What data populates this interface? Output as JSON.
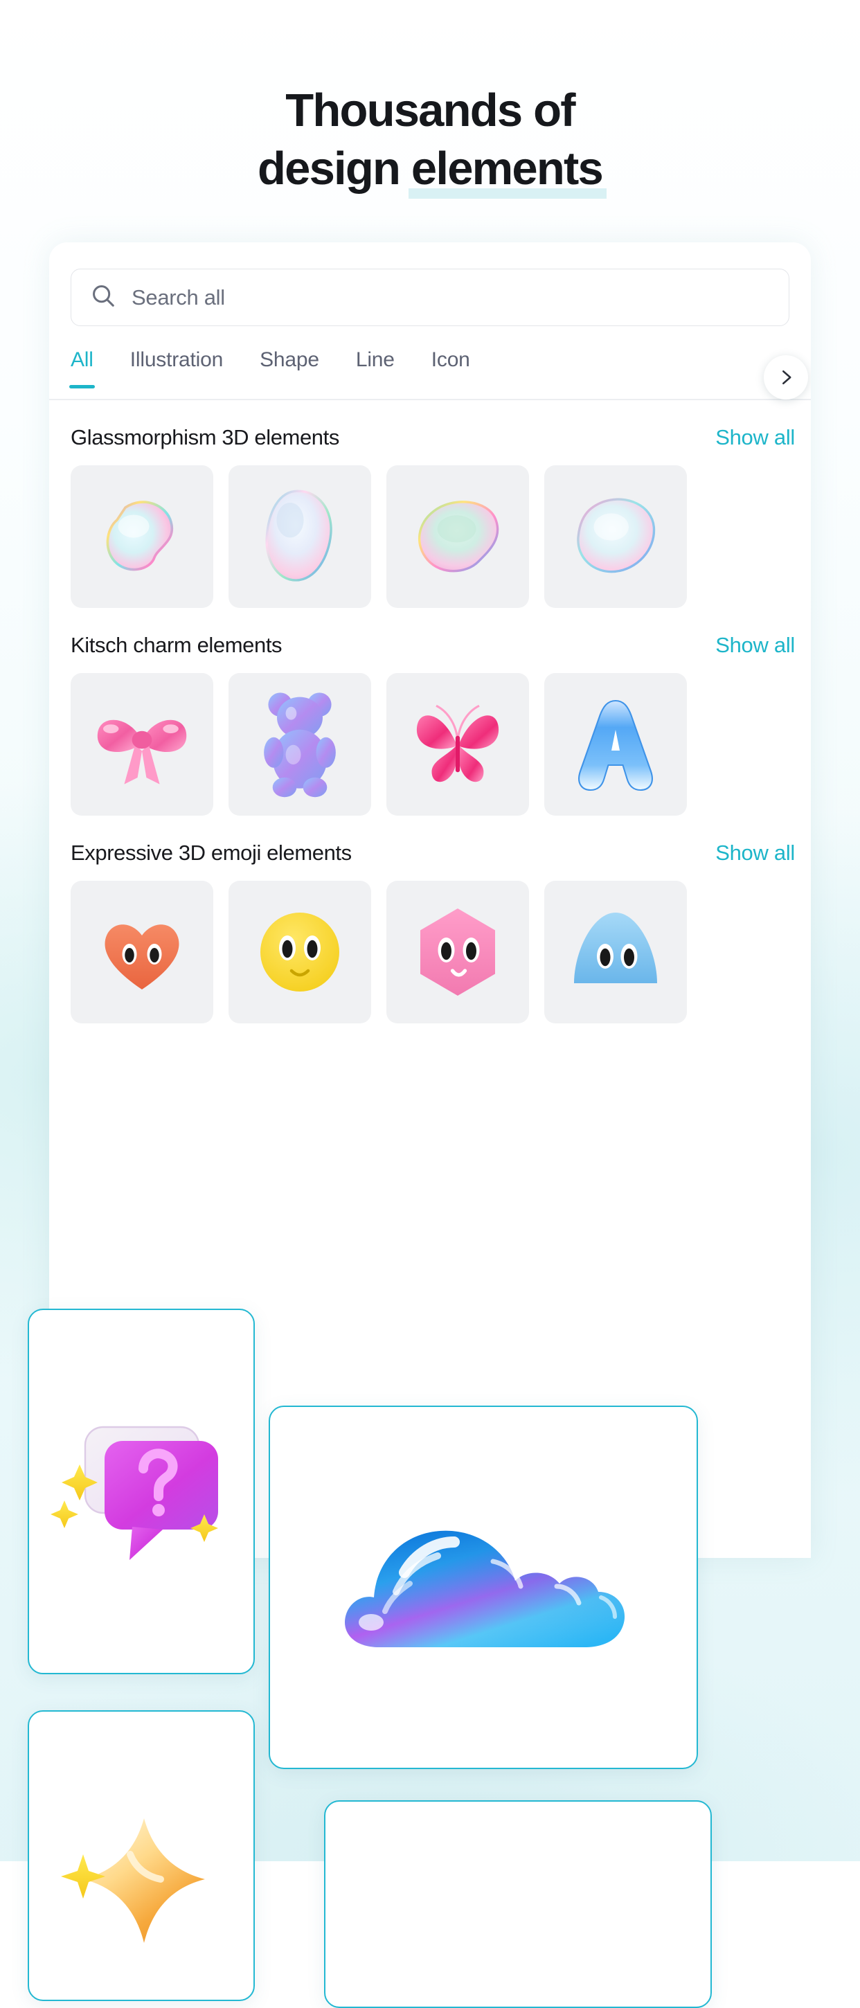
{
  "headline": {
    "line1": "Thousands of",
    "line2_prefix": "design ",
    "line2_highlight": "elements"
  },
  "colors": {
    "accent_teal": "#1db5c9",
    "card_border": "#23b8d2",
    "highlight_bar": "#d9f1f4",
    "thumb_bg": "#f0f1f3",
    "heading_text": "#18191d",
    "tab_inactive": "#5d6273"
  },
  "search": {
    "placeholder": "Search all",
    "icon": "search-icon"
  },
  "tabs": [
    {
      "label": "All",
      "active": true
    },
    {
      "label": "Illustration",
      "active": false
    },
    {
      "label": "Shape",
      "active": false
    },
    {
      "label": "Line",
      "active": false
    },
    {
      "label": "Icon",
      "active": false
    }
  ],
  "tab_next_icon": "chevron-right-icon",
  "sections": [
    {
      "title": "Glassmorphism 3D elements",
      "show_all": "Show all",
      "items": [
        {
          "name": "iridescent-blob-1"
        },
        {
          "name": "iridescent-blob-2"
        },
        {
          "name": "iridescent-blob-3"
        },
        {
          "name": "iridescent-blob-4"
        }
      ]
    },
    {
      "title": "Kitsch charm elements",
      "show_all": "Show all",
      "items": [
        {
          "name": "pink-bow"
        },
        {
          "name": "gummy-bear"
        },
        {
          "name": "pink-butterfly"
        },
        {
          "name": "blue-letter-a"
        }
      ]
    },
    {
      "title": "Expressive 3D emoji elements",
      "show_all": "Show all",
      "items": [
        {
          "name": "orange-fuzzy-heart"
        },
        {
          "name": "yellow-fuzzy-face"
        },
        {
          "name": "pink-fuzzy-hexagon-face"
        },
        {
          "name": "blue-fuzzy-dome-face"
        }
      ]
    }
  ],
  "float_cards": [
    {
      "name": "question-speech-bubble"
    },
    {
      "name": "gradient-cloud"
    },
    {
      "name": "yellow-star"
    },
    {
      "name": "partial-card"
    }
  ]
}
